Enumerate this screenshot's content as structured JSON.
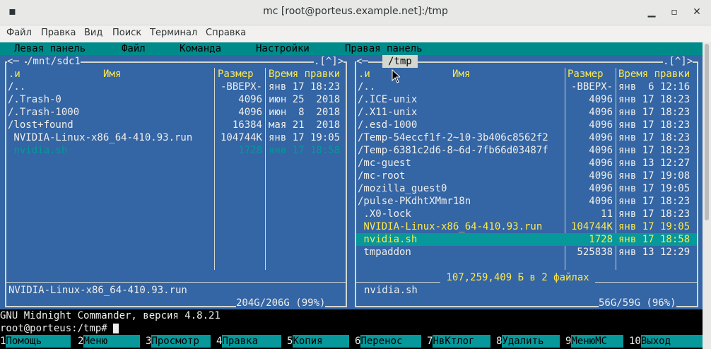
{
  "window": {
    "title": "mc [root@porteus.example.net]:/tmp"
  },
  "menubar": [
    "Файл",
    "Правка",
    "Вид",
    "Поиск",
    "Терминал",
    "Справка"
  ],
  "mc_menu": [
    "Левая панель",
    "Файл",
    "Команда",
    "Настройки",
    "Правая панель"
  ],
  "left_panel": {
    "path": "/mnt/sdc1",
    "corner": ".[^]>",
    "headers": {
      "sort": ".и",
      "name": "Имя",
      "size": "Размер",
      "time": "Время правки"
    },
    "rows": [
      {
        "name": "/..",
        "size": "-ВВЕРХ-",
        "time": "янв 17 18:23",
        "style": "w"
      },
      {
        "name": "/.Trash-0",
        "size": "4096",
        "time": "июн 25  2018",
        "style": "w"
      },
      {
        "name": "/.Trash-1000",
        "size": "4096",
        "time": "июн  8  2018",
        "style": "w"
      },
      {
        "name": "/lost+found",
        "size": "16384",
        "time": "мая 21  2018",
        "style": "w"
      },
      {
        "name": " NVIDIA-Linux-x86_64-410.93.run",
        "size": "104744K",
        "time": "янв 17 19:05",
        "style": "w"
      },
      {
        "name": " nvidia.sh",
        "size": "1728",
        "time": "янв 17 18:58",
        "style": "cy"
      }
    ],
    "mini_status": "NVIDIA-Linux-x86_64-410.93.run",
    "disk": "204G/206G (99%)"
  },
  "right_panel": {
    "path": "/tmp",
    "corner": ".[^]>",
    "headers": {
      "sort": ".и",
      "name": "Имя",
      "size": "Размер",
      "time": "Время правки"
    },
    "rows": [
      {
        "name": "/..",
        "size": "-ВВЕРХ-",
        "time": "янв  6 12:16",
        "style": "w"
      },
      {
        "name": "/.ICE-unix",
        "size": "4096",
        "time": "янв 17 18:23",
        "style": "w"
      },
      {
        "name": "/.X11-unix",
        "size": "4096",
        "time": "янв 17 18:23",
        "style": "w"
      },
      {
        "name": "/.esd-1000",
        "size": "4096",
        "time": "янв 17 18:23",
        "style": "w"
      },
      {
        "name": "/Temp-54eccf1f-2~10-3b406c8562f2",
        "size": "4096",
        "time": "янв 17 18:23",
        "style": "w"
      },
      {
        "name": "/Temp-6381c2d6-8~6d-7fb66d03487f",
        "size": "4096",
        "time": "янв 17 18:23",
        "style": "w"
      },
      {
        "name": "/mc-guest",
        "size": "4096",
        "time": "янв 13 12:27",
        "style": "w"
      },
      {
        "name": "/mc-root",
        "size": "4096",
        "time": "янв 17 19:08",
        "style": "w"
      },
      {
        "name": "/mozilla_guest0",
        "size": "4096",
        "time": "янв 17 19:05",
        "style": "w"
      },
      {
        "name": "/pulse-PKdhtXMmr18n",
        "size": "4096",
        "time": "янв 17 18:23",
        "style": "w"
      },
      {
        "name": " .X0-lock",
        "size": "11",
        "time": "янв 17 18:23",
        "style": "w"
      },
      {
        "name": " NVIDIA-Linux-x86_64-410.93.run",
        "size": "104744K",
        "time": "янв 17 19:05",
        "style": "y"
      },
      {
        "name": " nvidia.sh",
        "size": "1728",
        "time": "янв 17 18:58",
        "style": "ysel"
      },
      {
        "name": " tmpaddon",
        "size": "525838",
        "time": "янв 13 12:29",
        "style": "w"
      }
    ],
    "selection_info": " 107,259,409 Б в 2 файлах ",
    "mini_status": "nvidia.sh",
    "disk": "56G/59G (96%)"
  },
  "status_line": "GNU Midnight Commander, версия 4.8.21",
  "prompt": "root@porteus:/tmp# ",
  "fkeys": [
    {
      "num": "1",
      "label": "Помощь"
    },
    {
      "num": "2",
      "label": "Меню"
    },
    {
      "num": "3",
      "label": "Просмотр"
    },
    {
      "num": "4",
      "label": "Правка"
    },
    {
      "num": "5",
      "label": "Копия"
    },
    {
      "num": "6",
      "label": "Перенос"
    },
    {
      "num": "7",
      "label": "НвКтлог"
    },
    {
      "num": "8",
      "label": "Удалить"
    },
    {
      "num": "9",
      "label": "МенюMC"
    },
    {
      "num": "10",
      "label": "Выход"
    }
  ],
  "colors": {
    "panel": "#3465a4",
    "accent": "#06989a",
    "highlight": "#fce94f"
  }
}
